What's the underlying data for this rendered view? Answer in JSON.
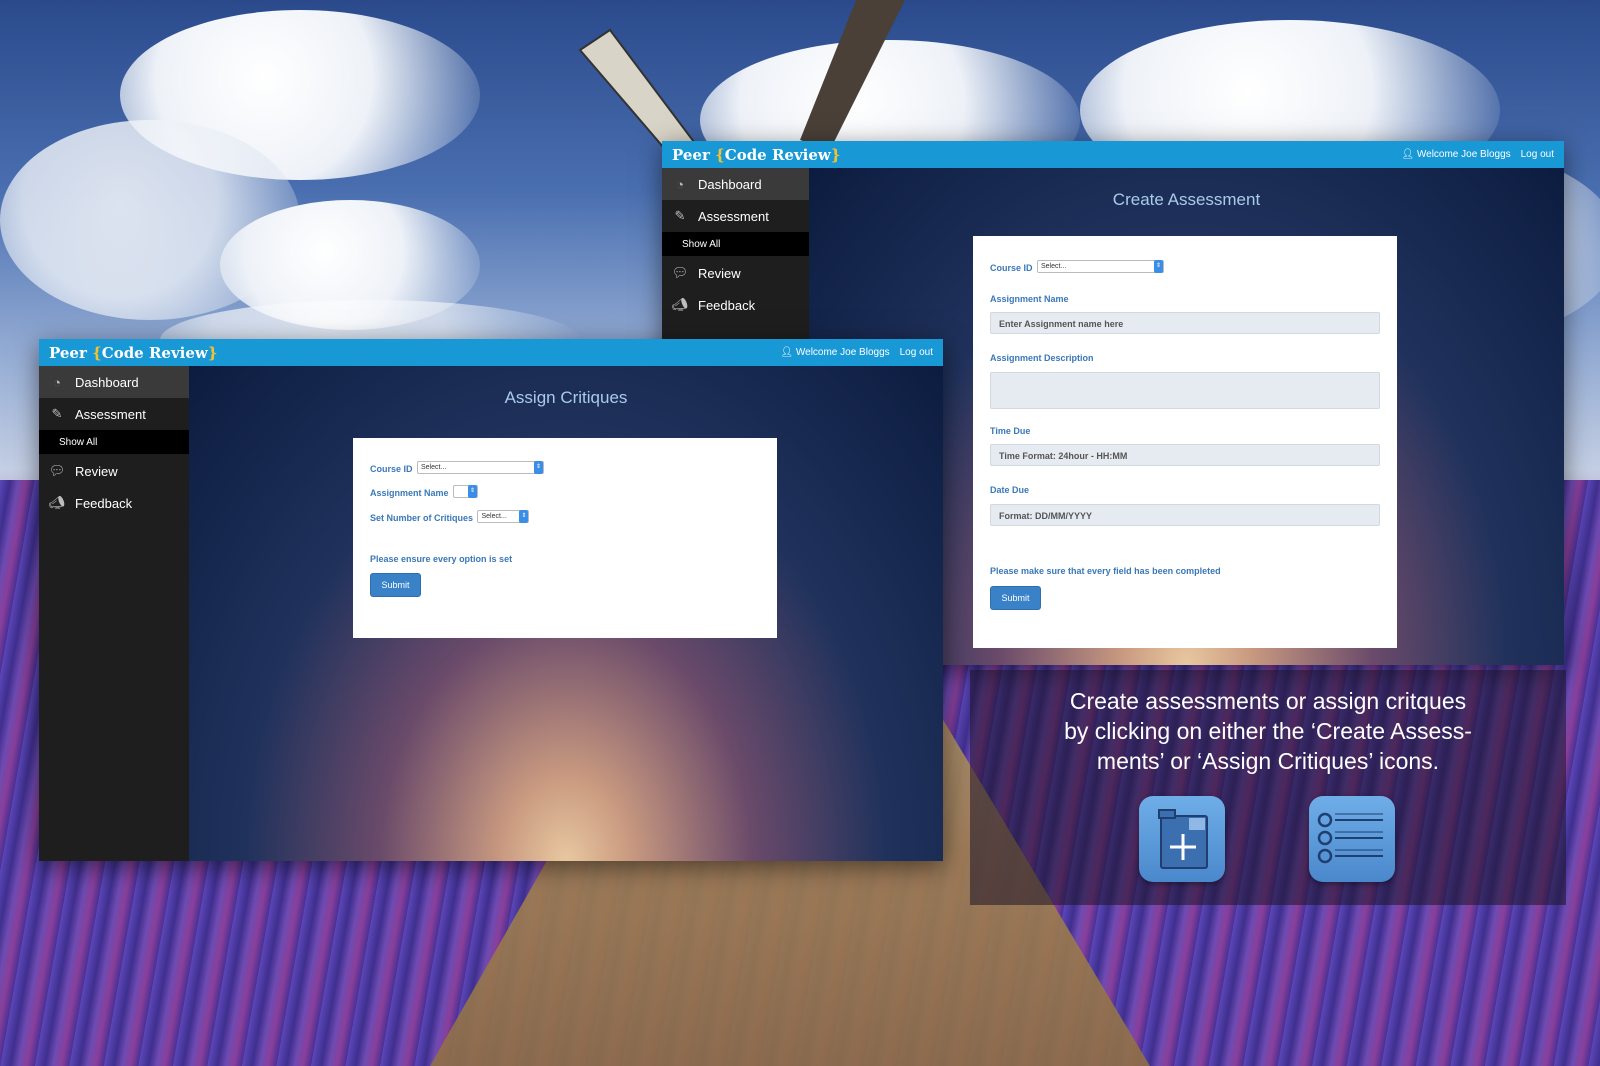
{
  "back_window": {
    "brand_prefix": "Peer ",
    "brand_open": "{",
    "brand_main": "Code Review",
    "brand_close": "}",
    "welcome": "Welcome Joe Bloggs",
    "logout": "Log out",
    "sidebar": {
      "dashboard": "Dashboard",
      "assessment": "Assessment",
      "show_all": "Show All",
      "review": "Review",
      "feedback": "Feedback"
    },
    "title": "Create Assessment",
    "form": {
      "course_id_label": "Course ID",
      "course_id_value": "Select...",
      "assignment_name_label": "Assignment Name",
      "assignment_name_placeholder": "Enter Assignment name here",
      "assignment_desc_label": "Assignment Description",
      "time_due_label": "Time Due",
      "time_due_placeholder": "Time Format: 24hour - HH:MM",
      "date_due_label": "Date Due",
      "date_due_placeholder": "Format: DD/MM/YYYY",
      "note": "Please make sure that every field has been completed",
      "submit": "Submit"
    }
  },
  "front_window": {
    "brand_prefix": "Peer ",
    "brand_open": "{",
    "brand_main": "Code Review",
    "brand_close": "}",
    "welcome": "Welcome Joe Bloggs",
    "logout": "Log out",
    "sidebar": {
      "dashboard": "Dashboard",
      "assessment": "Assessment",
      "show_all": "Show All",
      "review": "Review",
      "feedback": "Feedback"
    },
    "title": "Assign Critiques",
    "form": {
      "course_id_label": "Course ID",
      "course_id_value": "Select...",
      "assignment_name_label": "Assignment Name",
      "critiques_label": "Set Number of Critiques",
      "critiques_value": "Select...",
      "note": "Please ensure every option is set",
      "submit": "Submit"
    }
  },
  "caption": {
    "line1": "Create assessments or assign critques",
    "line2": "by clicking on either the ‘Create Assess-",
    "line3": "ments’ or ‘Assign Critiques’ icons."
  },
  "icons": {
    "create": "create-assessment-icon",
    "assign": "assign-critiques-icon"
  },
  "colors": {
    "topbar": "#1899d6",
    "brace": "#f2c230",
    "label": "#3a78b8",
    "button": "#3a82c8",
    "sidebar": "#1e1e1e"
  }
}
